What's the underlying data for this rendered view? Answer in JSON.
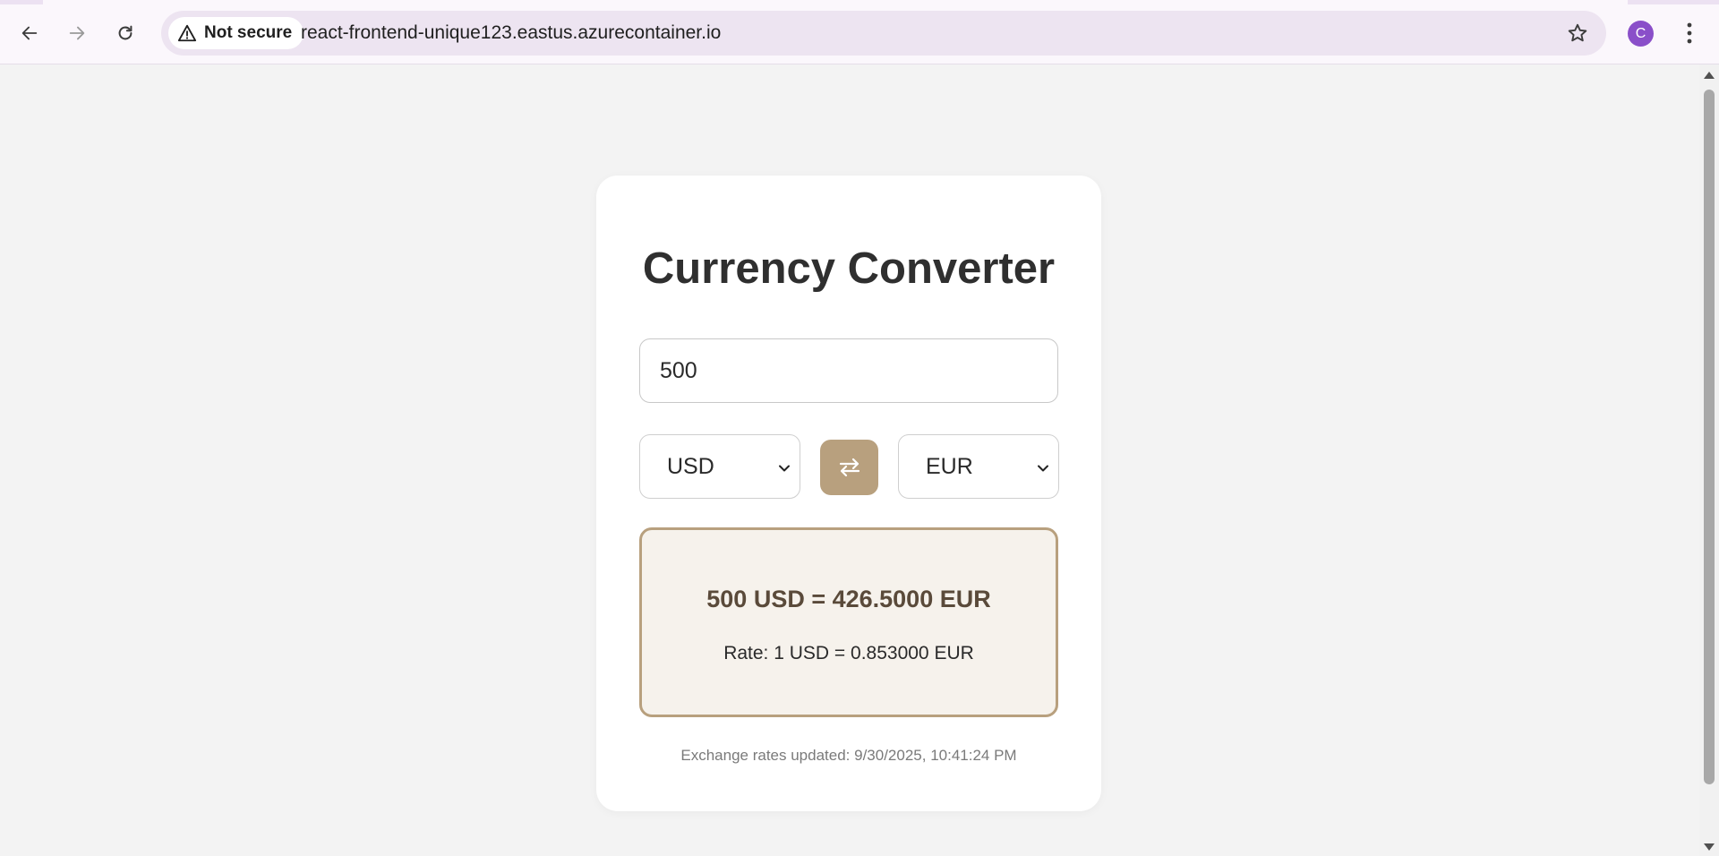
{
  "browser": {
    "security_label": "Not secure",
    "url": "react-frontend-unique123.eastus.azurecontainer.io",
    "profile_initial": "C",
    "icons": {
      "back": "back-arrow-icon",
      "forward": "forward-arrow-icon",
      "reload": "reload-icon",
      "warning": "warning-triangle-icon",
      "bookmark": "star-icon",
      "menu": "vertical-dots-icon"
    },
    "colors": {
      "chrome_bg": "#fbf7fc",
      "omnibox_bg": "#ede4f1",
      "avatar_bg": "#8a4fc9"
    }
  },
  "converter": {
    "title": "Currency Converter",
    "amount": "500",
    "from_currency": "USD",
    "to_currency": "EUR",
    "swap_icon": "swap-arrows-icon",
    "result_text": "500 USD = 426.5000 EUR",
    "rate_text": "Rate: 1 USD = 0.853000 EUR",
    "updated_text": "Exchange rates updated: 9/30/2025, 10:41:24 PM",
    "colors": {
      "accent": "#b8a07e",
      "result_bg": "#f6f2ec",
      "result_text": "#5a4a3a",
      "page_bg": "#f3f3f3"
    }
  }
}
